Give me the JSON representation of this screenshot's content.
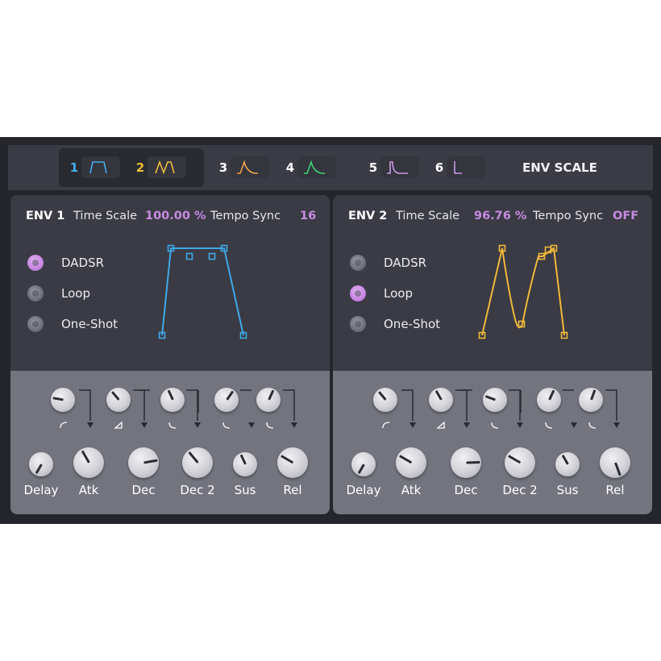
{
  "tabs": [
    {
      "num": "1",
      "color": "#46aef0",
      "icon": "dadsr-shape-icon"
    },
    {
      "num": "2",
      "color": "#f0be3c",
      "icon": "loop-shape-icon"
    },
    {
      "num": "3",
      "color": "#f0a04a",
      "icon": "peak-shape-icon"
    },
    {
      "num": "4",
      "color": "#3ed27a",
      "icon": "peak-shape-icon"
    },
    {
      "num": "5",
      "color": "#c99ae6",
      "icon": "pulse-shape-icon"
    },
    {
      "num": "6",
      "color": "#c99ae6",
      "icon": "l-shape-icon"
    }
  ],
  "env_scale_label": "ENV SCALE",
  "env1": {
    "name": "ENV 1",
    "time_scale_label": "Time Scale",
    "time_scale_value": "100.00 %",
    "tempo_sync_label": "Tempo Sync",
    "tempo_sync_value": "16",
    "modes": [
      {
        "label": "DADSR",
        "selected": true
      },
      {
        "label": "Loop",
        "selected": false
      },
      {
        "label": "One-Shot",
        "selected": false
      }
    ],
    "color": "#3fa8e8",
    "knobs_top": [
      {
        "name": "delay-curve",
        "angle": -80
      },
      {
        "name": "attack-curve",
        "angle": -40
      },
      {
        "name": "decay-curve",
        "angle": -25
      },
      {
        "name": "decay2-curve",
        "angle": 35
      },
      {
        "name": "sustain-curve",
        "angle": 25
      }
    ],
    "knobs_bottom": [
      {
        "label": "Delay",
        "angle": -150
      },
      {
        "label": "Atk",
        "angle": -30
      },
      {
        "label": "Dec",
        "angle": 80
      },
      {
        "label": "Dec 2",
        "angle": -40
      },
      {
        "label": "Sus",
        "angle": -25
      },
      {
        "label": "Rel",
        "angle": -60
      }
    ]
  },
  "env2": {
    "name": "ENV 2",
    "time_scale_label": "Time Scale",
    "time_scale_value": "96.76 %",
    "tempo_sync_label": "Tempo Sync",
    "tempo_sync_value": "OFF",
    "modes": [
      {
        "label": "DADSR",
        "selected": false
      },
      {
        "label": "Loop",
        "selected": true
      },
      {
        "label": "One-Shot",
        "selected": false
      }
    ],
    "color": "#f0b93a",
    "knobs_top": [
      {
        "name": "delay-curve",
        "angle": -40
      },
      {
        "name": "attack-curve",
        "angle": -30
      },
      {
        "name": "decay-curve",
        "angle": -70
      },
      {
        "name": "decay2-curve",
        "angle": 25
      },
      {
        "name": "sustain-curve",
        "angle": 20
      }
    ],
    "knobs_bottom": [
      {
        "label": "Delay",
        "angle": -150
      },
      {
        "label": "Atk",
        "angle": -60
      },
      {
        "label": "Dec",
        "angle": 88
      },
      {
        "label": "Dec 2",
        "angle": -60
      },
      {
        "label": "Sus",
        "angle": -30
      },
      {
        "label": "Rel",
        "angle": 160
      }
    ]
  }
}
